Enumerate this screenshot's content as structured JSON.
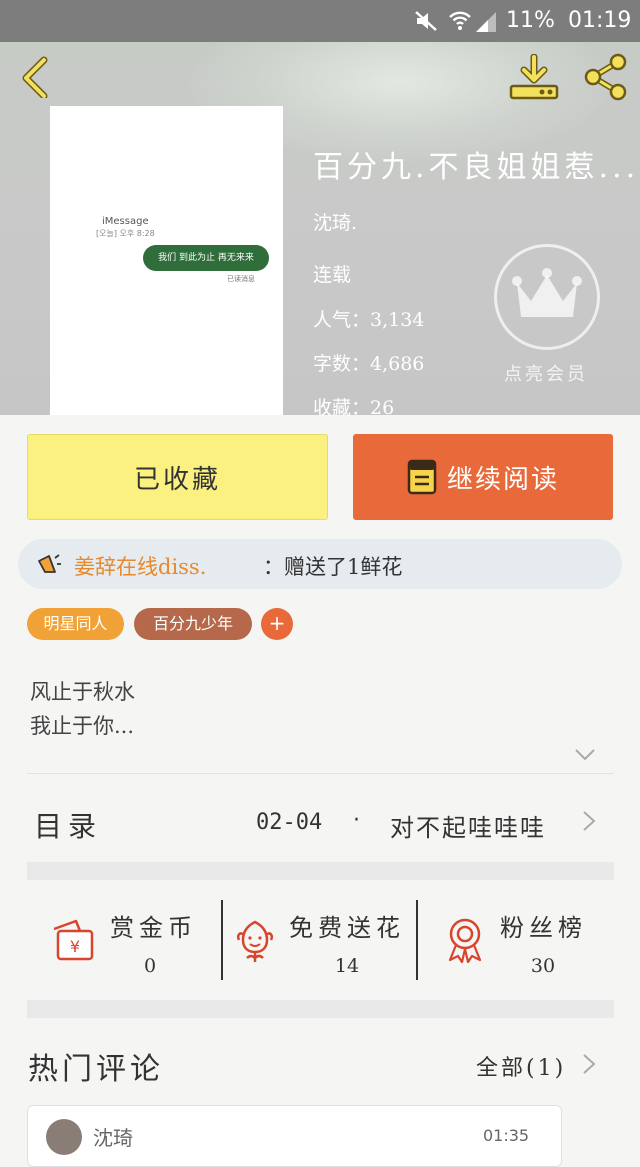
{
  "status_bar": {
    "battery": "11%",
    "time": "01:19",
    "icons": [
      "mute-icon",
      "wifi-icon",
      "signal-icon"
    ]
  },
  "header": {
    "icons": [
      "back-icon",
      "download-icon",
      "share-icon"
    ]
  },
  "cover": {
    "imessage": "iMessage",
    "date_line": "[오늘] 오후 8:28",
    "bubble_text": "我们 到此为止 再无来来",
    "read_text": "已读消息"
  },
  "book": {
    "title": "百分九.不良姐姐惹...",
    "author": "沈琦.",
    "status": "连载",
    "popularity": "人气：3,134",
    "words": "字数：4,686",
    "favorites": "收藏：26"
  },
  "vip": {
    "label": "点亮会员"
  },
  "actions": {
    "favorited": "已收藏",
    "continue_reading": "继续阅读"
  },
  "gift": {
    "user": "姜辞在线diss.",
    "text": "：赠送了1鲜花"
  },
  "tags": [
    "明星同人",
    "百分九少年"
  ],
  "tag_add": "+",
  "intro": [
    "风止于秋水",
    "我止于你..."
  ],
  "toc": {
    "label": "目录",
    "date": "02-04",
    "dot": "·",
    "chapter": "对不起哇哇哇"
  },
  "stats": [
    {
      "label": "赏金币",
      "value": "0",
      "icon": "gold-coin-icon"
    },
    {
      "label": "免费送花",
      "value": "14",
      "icon": "flower-icon"
    },
    {
      "label": "粉丝榜",
      "value": "30",
      "icon": "ribbon-icon"
    }
  ],
  "comments": {
    "title": "热门评论",
    "all": "全部(1)",
    "first_user": "沈琦",
    "first_time": "01:35"
  },
  "colors": {
    "accent_orange": "#e8693a",
    "yellow_button": "#fbf180",
    "tag_orange": "#f1a236",
    "tag_brown": "#b5694a",
    "gift_user": "#e7892c"
  }
}
